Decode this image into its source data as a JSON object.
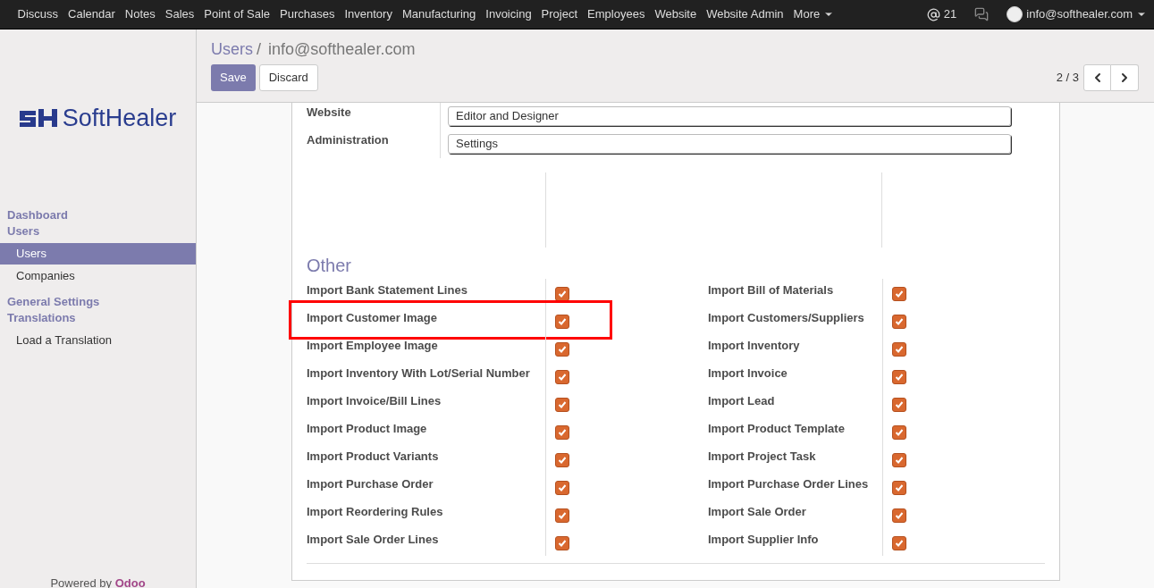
{
  "top_menu": [
    {
      "label": "Discuss"
    },
    {
      "label": "Calendar"
    },
    {
      "label": "Notes"
    },
    {
      "label": "Sales"
    },
    {
      "label": "Point of Sale"
    },
    {
      "label": "Purchases"
    },
    {
      "label": "Inventory"
    },
    {
      "label": "Manufacturing"
    },
    {
      "label": "Invoicing"
    },
    {
      "label": "Project"
    },
    {
      "label": "Employees"
    },
    {
      "label": "Website"
    },
    {
      "label": "Website Admin"
    },
    {
      "label": "More"
    }
  ],
  "systray": {
    "mentions": "21",
    "user": "info@softhealer.com"
  },
  "logo": {
    "text": "SoftHealer"
  },
  "sidebar": [
    {
      "kind": "header",
      "label": "Dashboard"
    },
    {
      "kind": "header",
      "label": "Users"
    },
    {
      "kind": "item",
      "label": "Users",
      "selected": true
    },
    {
      "kind": "item",
      "label": "Companies",
      "selected": false
    },
    {
      "kind": "header",
      "label": "General Settings"
    },
    {
      "kind": "header",
      "label": "Translations"
    },
    {
      "kind": "item",
      "label": "Load a Translation",
      "selected": false
    }
  ],
  "powered_by": {
    "text": "Powered by",
    "brand": "Odoo"
  },
  "breadcrumb": {
    "parent": "Users",
    "separator": "/",
    "current": "info@softhealer.com"
  },
  "buttons": {
    "save": "Save",
    "discard": "Discard"
  },
  "pager": "2 / 3",
  "access_fields": [
    {
      "label": "Website",
      "value": "Editor and Designer"
    },
    {
      "label": "Administration",
      "value": "Settings"
    }
  ],
  "other": {
    "title": "Other",
    "items": [
      {
        "label": "Import Bank Statement Lines",
        "checked": true,
        "highlighted": false
      },
      {
        "label": "Import Bill of Materials",
        "checked": true,
        "highlighted": false
      },
      {
        "label": "Import Customer Image",
        "checked": true,
        "highlighted": true
      },
      {
        "label": "Import Customers/Suppliers",
        "checked": true,
        "highlighted": false
      },
      {
        "label": "Import Employee Image",
        "checked": true,
        "highlighted": false
      },
      {
        "label": "Import Inventory",
        "checked": true,
        "highlighted": false
      },
      {
        "label": "Import Inventory With Lot/Serial Number",
        "checked": true,
        "highlighted": false
      },
      {
        "label": "Import Invoice",
        "checked": true,
        "highlighted": false
      },
      {
        "label": "Import Invoice/Bill Lines",
        "checked": true,
        "highlighted": false
      },
      {
        "label": "Import Lead",
        "checked": true,
        "highlighted": false
      },
      {
        "label": "Import Product Image",
        "checked": true,
        "highlighted": false
      },
      {
        "label": "Import Product Template",
        "checked": true,
        "highlighted": false
      },
      {
        "label": "Import Product Variants",
        "checked": true,
        "highlighted": false
      },
      {
        "label": "Import Project Task",
        "checked": true,
        "highlighted": false
      },
      {
        "label": "Import Purchase Order",
        "checked": true,
        "highlighted": false
      },
      {
        "label": "Import Purchase Order Lines",
        "checked": true,
        "highlighted": false
      },
      {
        "label": "Import Reordering Rules",
        "checked": true,
        "highlighted": false
      },
      {
        "label": "Import Sale Order",
        "checked": true,
        "highlighted": false
      },
      {
        "label": "Import Sale Order Lines",
        "checked": true,
        "highlighted": false
      },
      {
        "label": "Import Supplier Info",
        "checked": true,
        "highlighted": false
      }
    ]
  }
}
